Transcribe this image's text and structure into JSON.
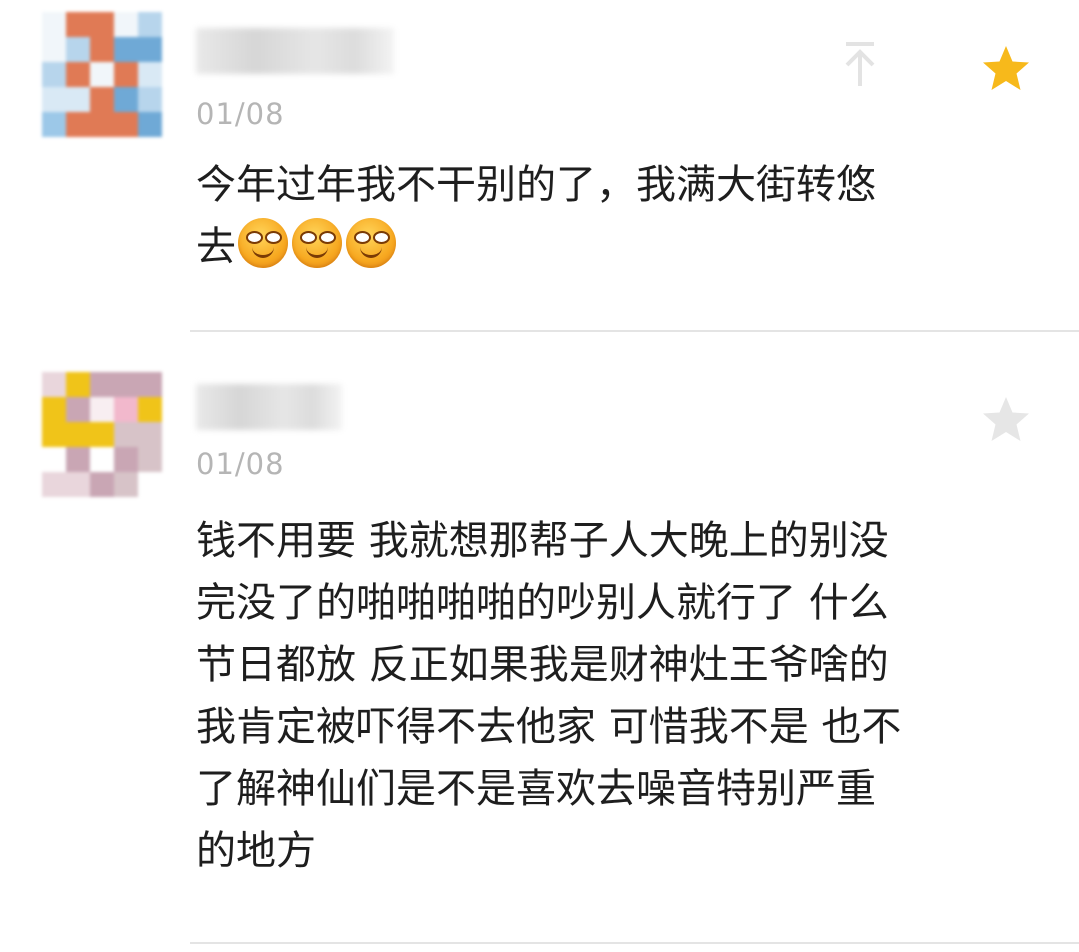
{
  "comments": [
    {
      "date": "01/08",
      "text": "今年过年我不干别的了，我满大街转悠\n去",
      "emoji_icons": [
        "grinning-face-icon",
        "grinning-face-icon",
        "grinning-face-icon"
      ],
      "starred": true,
      "star_color": "#f7b91b",
      "avatar_palette": [
        "#9cc8e8",
        "#6fa9d6",
        "#d9e9f5",
        "#c9a58a",
        "#e07a55",
        "#b7d5ec",
        "#f1f6fa"
      ]
    },
    {
      "date": "01/08",
      "text": "钱不用要 我就想那帮子人大晚上的别没\n完没了的啪啪啪啪的吵别人就行了 什么\n节日都放 反正如果我是财神灶王爷啥的\n我肯定被吓得不去他家 可惜我不是 也不\n了解神仙们是不是喜欢去噪音特别严重\n的地方",
      "starred": false,
      "star_color": "#e6e6e6",
      "avatar_palette": [
        "#f2b8cc",
        "#e9d6dc",
        "#f8eef1",
        "#f0c419",
        "#d7c3c8",
        "#c9a6b4",
        "#ffffff"
      ]
    }
  ],
  "icons": {
    "up": "arrow-up-icon",
    "star": "star-icon"
  }
}
